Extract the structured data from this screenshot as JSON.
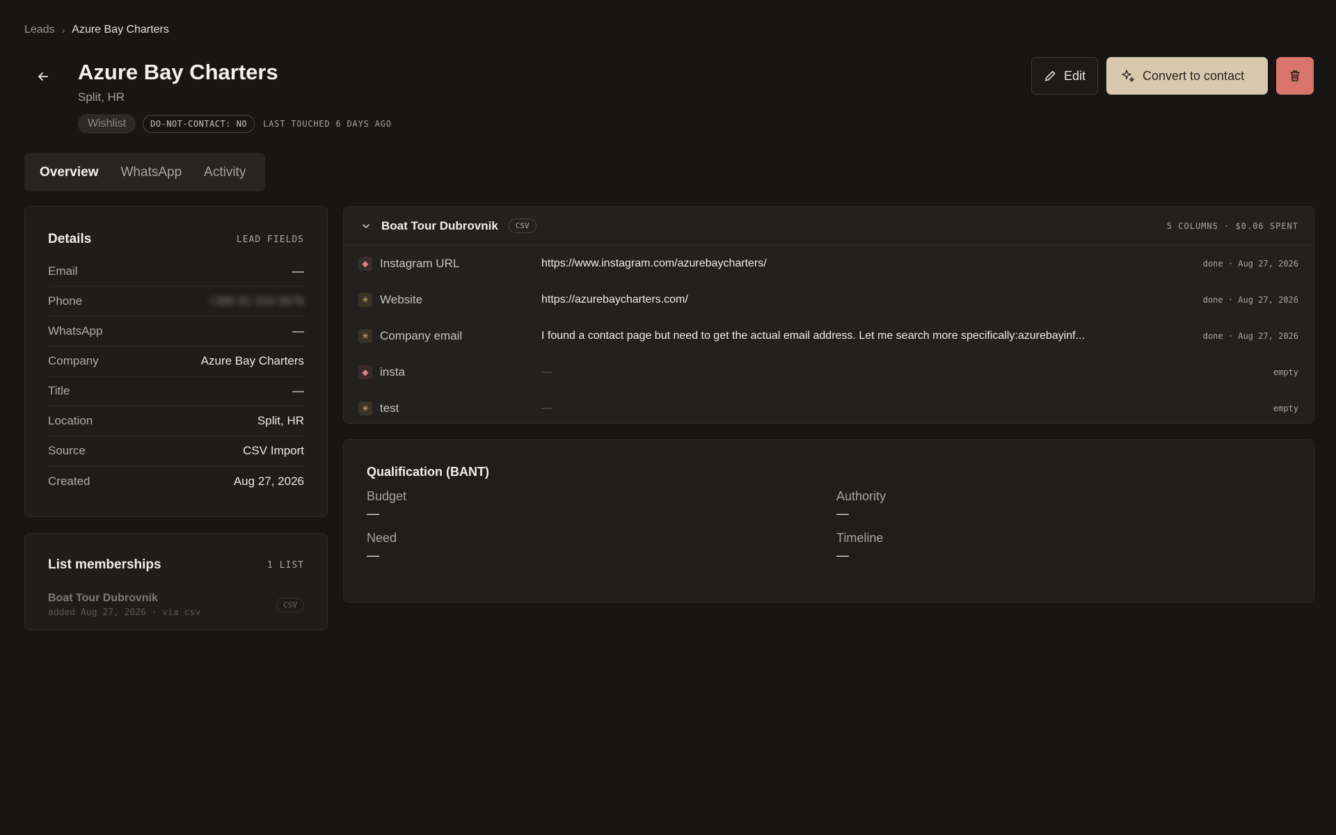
{
  "breadcrumb": {
    "parent": "Leads",
    "separator": "›",
    "current": "Azure Bay Charters"
  },
  "header": {
    "title": "Azure Bay Charters",
    "subtitle": "Split, HR",
    "status": "Wishlist",
    "dnc": "DO-NOT-CONTACT: NO",
    "last_touched": "LAST TOUCHED 6 DAYS AGO"
  },
  "actions": {
    "edit": "Edit",
    "convert": "Convert to contact"
  },
  "tabs": [
    {
      "label": "Overview"
    },
    {
      "label": "WhatsApp"
    },
    {
      "label": "Activity"
    }
  ],
  "details": {
    "title": "Details",
    "tag": "LEAD FIELDS",
    "rows": [
      {
        "label": "Email",
        "value": "—"
      },
      {
        "label": "Phone",
        "value": "+385 91 234 5678"
      },
      {
        "label": "WhatsApp",
        "value": "—"
      },
      {
        "label": "Company",
        "value": "Azure Bay Charters"
      },
      {
        "label": "Title",
        "value": "—"
      },
      {
        "label": "Location",
        "value": "Split, HR"
      },
      {
        "label": "Source",
        "value": "CSV Import"
      },
      {
        "label": "Created",
        "value": "Aug 27, 2026"
      }
    ]
  },
  "lists": {
    "title": "List memberships",
    "count": "1 LIST",
    "items": [
      {
        "name": "Boat Tour Dubrovnik",
        "sub": "added Aug 27, 2026 · via csv",
        "chip": "CSV"
      }
    ]
  },
  "enrichment": {
    "title": "Boat Tour Dubrovnik",
    "chip": "CSV",
    "meta": "5 COLUMNS · $0.06 SPENT",
    "rows": [
      {
        "icon": "instagram-icon",
        "name": "Instagram URL",
        "value": "https://www.instagram.com/azurebaycharters/",
        "status": "done · Aug 27, 2026"
      },
      {
        "icon": "sparkle-icon",
        "name": "Website",
        "value": "https://azurebaycharters.com/",
        "status": "done · Aug 27, 2026"
      },
      {
        "icon": "sparkle-icon",
        "name": "Company email",
        "value": "I found a contact page but need to get the actual email address. Let me search more specifically:azurebayinf...",
        "status": "done · Aug 27, 2026"
      },
      {
        "icon": "instagram-icon",
        "name": "insta",
        "value": "—",
        "status": "empty"
      },
      {
        "icon": "sparkle-icon",
        "name": "test",
        "value": "—",
        "status": "empty"
      }
    ]
  },
  "bant": {
    "title": "Qualification (BANT)",
    "budget": {
      "label": "Budget",
      "value": "—"
    },
    "authority": {
      "label": "Authority",
      "value": "—"
    },
    "need": {
      "label": "Need",
      "value": "—"
    },
    "timeline": {
      "label": "Timeline",
      "value": "—"
    }
  },
  "colors": {
    "background": "#171615",
    "accent": "#d8c9ae",
    "danger": "#d9756c"
  }
}
